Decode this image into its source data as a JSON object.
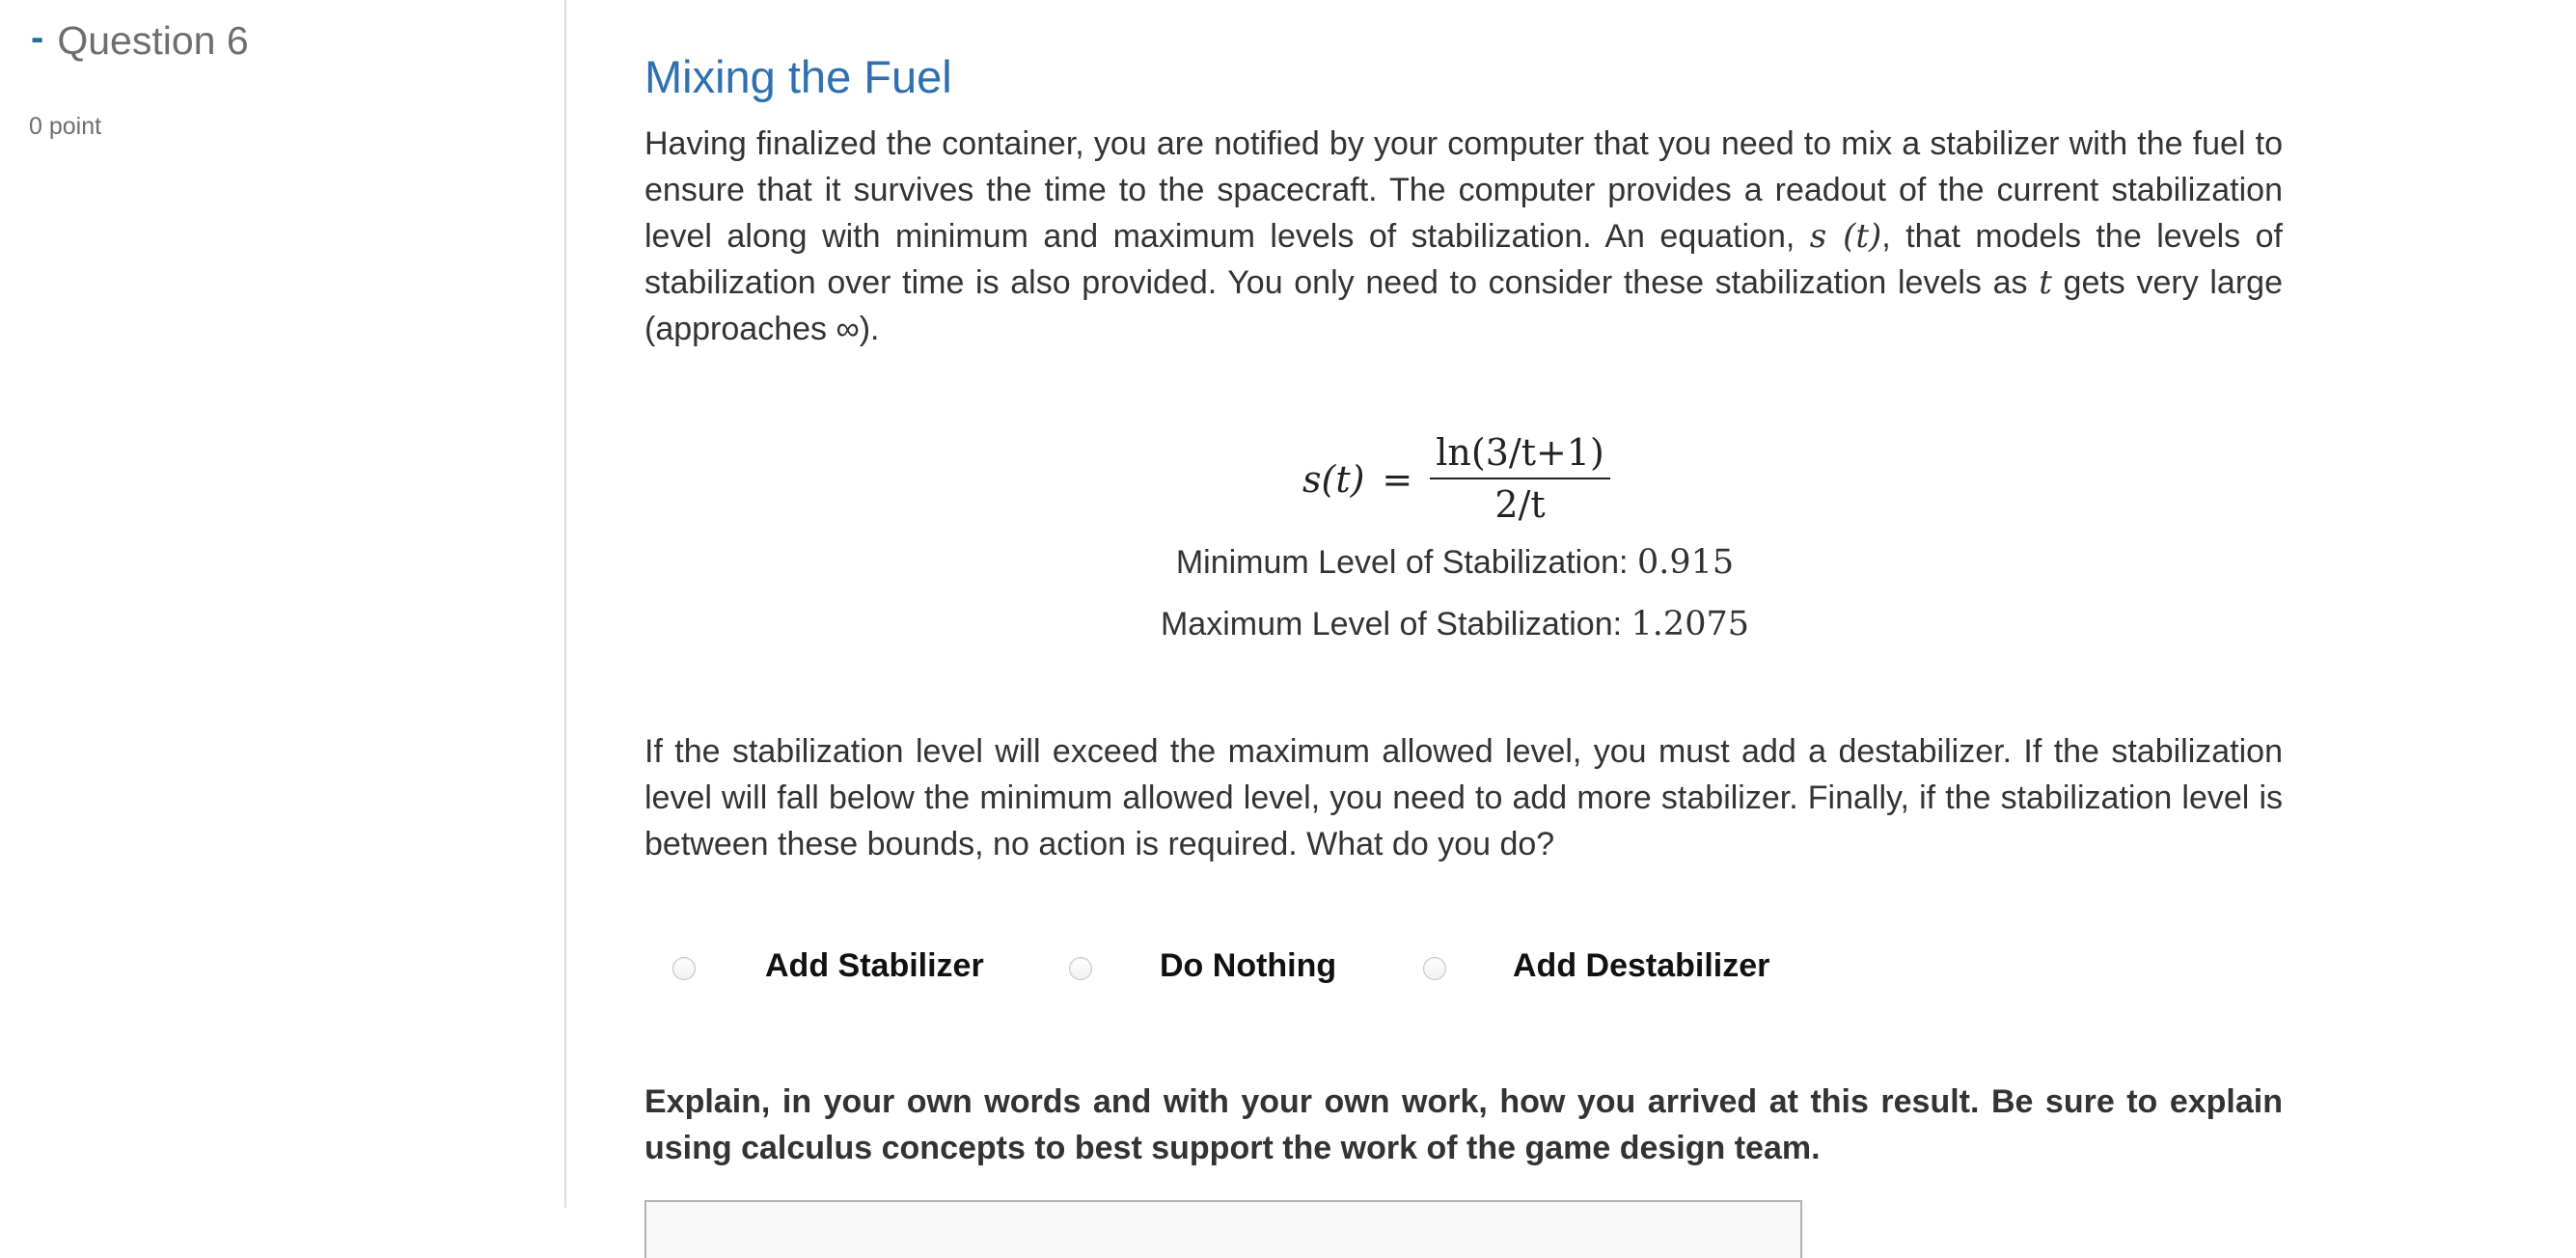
{
  "sidebar": {
    "collapse_symbol": "-",
    "question_title": "Question 6",
    "points": "0 point"
  },
  "main": {
    "title": "Mixing the Fuel",
    "intro": {
      "part1": "Having finalized the container, you are notified by your computer that you need to mix a stabilizer with the fuel to ensure that it survives the time to the spacecraft. The computer provides a readout of the current stabilization level along with minimum and maximum levels of stabilization. An equation, ",
      "math1": "s (t)",
      "part2": ", that models the levels of stabilization over time is also provided. You only need to consider these stabilization levels as ",
      "math2": "t",
      "part3": " gets very large (approaches ∞)."
    },
    "equation": {
      "lhs": "s(t)",
      "equals": "=",
      "numerator": "ln(3/t+1)",
      "denominator": "2/t"
    },
    "levels": {
      "min_label": "Minimum Level of Stabilization: ",
      "min_value": "0.915",
      "max_label": "Maximum Level of Stabilization: ",
      "max_value": "1.2075"
    },
    "question": "If the stabilization level will exceed the maximum allowed level, you must add a destabilizer. If the stabilization level will fall below the minimum allowed level, you need to add more stabilizer. Finally, if the stabilization level is between these bounds, no action is required. What do you do?",
    "options": [
      {
        "label": "Add Stabilizer",
        "selected": false
      },
      {
        "label": "Do Nothing",
        "selected": false
      },
      {
        "label": "Add Destabilizer",
        "selected": false
      }
    ],
    "explain_prompt": "Explain, in your own words and with your own work, how you arrived at this result. Be sure to explain using calculus concepts to best support the work of the game design team.",
    "answer_value": ""
  },
  "colors": {
    "title": "#2f70b0",
    "collapse_accent": "#2a6f97",
    "sidebar_text": "#6e6e6e",
    "body_text": "#333333",
    "divider": "#dddddd"
  }
}
